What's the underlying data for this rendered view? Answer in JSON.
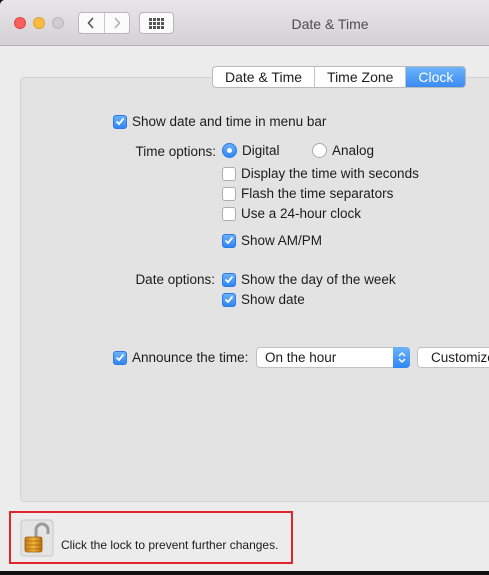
{
  "window": {
    "title": "Date & Time"
  },
  "tabs": [
    {
      "label": "Date & Time",
      "active": false
    },
    {
      "label": "Time Zone",
      "active": false
    },
    {
      "label": "Clock",
      "active": true
    }
  ],
  "clock": {
    "show_in_menu_bar": {
      "label": "Show date and time in menu bar",
      "checked": true
    },
    "time_options_label": "Time options:",
    "digital": {
      "label": "Digital",
      "selected": true
    },
    "analog": {
      "label": "Analog",
      "selected": false
    },
    "seconds": {
      "label": "Display the time with seconds",
      "checked": false
    },
    "flash": {
      "label": "Flash the time separators",
      "checked": false
    },
    "twentyfour": {
      "label": "Use a 24-hour clock",
      "checked": false
    },
    "ampm": {
      "label": "Show AM/PM",
      "checked": true
    },
    "date_options_label": "Date options:",
    "day_of_week": {
      "label": "Show the day of the week",
      "checked": true
    },
    "show_date": {
      "label": "Show date",
      "checked": true
    },
    "announce": {
      "label": "Announce the time:",
      "checked": true
    },
    "announce_interval": "On the hour",
    "customize_label": "Customize Voice..."
  },
  "footer": {
    "lock_text": "Click the lock to prevent further changes."
  },
  "colors": {
    "accent": "#3a8bf3",
    "highlight_box": "#e3242b"
  }
}
